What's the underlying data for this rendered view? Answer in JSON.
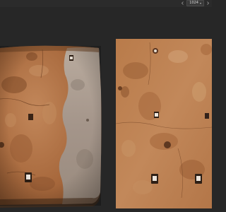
{
  "top_bar": {
    "resolution_value": "1024",
    "prev_icon": "chevron-left-icon",
    "next_icon": "chevron-right-icon"
  },
  "viewports": {
    "left_icon": "3d-view",
    "right_icon": "2d-view"
  },
  "colors": {
    "background": "#272727",
    "plaster_base": "#b07446",
    "plaster_dark": "#8d5a35",
    "plaster_light": "#c99566",
    "concrete_gray": "#a3958a"
  }
}
